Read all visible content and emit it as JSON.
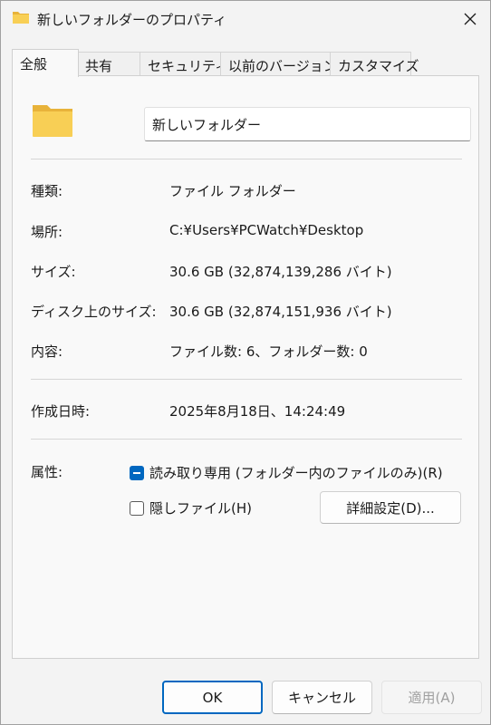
{
  "window": {
    "title": "新しいフォルダーのプロパティ"
  },
  "tabs": [
    {
      "label": "全般"
    },
    {
      "label": "共有"
    },
    {
      "label": "セキュリティ"
    },
    {
      "label": "以前のバージョン"
    },
    {
      "label": "カスタマイズ"
    }
  ],
  "general": {
    "name_value": "新しいフォルダー",
    "type_label": "種類:",
    "type_value": "ファイル フォルダー",
    "location_label": "場所:",
    "location_value": "C:¥Users¥PCWatch¥Desktop",
    "size_label": "サイズ:",
    "size_value": "30.6 GB (32,874,139,286 バイト)",
    "disk_size_label": "ディスク上のサイズ:",
    "disk_size_value": "30.6 GB (32,874,151,936 バイト)",
    "contents_label": "内容:",
    "contents_value": "ファイル数: 6、フォルダー数: 0",
    "created_label": "作成日時:",
    "created_value": "2025年8月18日、14:24:49",
    "attributes_label": "属性:",
    "readonly_label": "読み取り専用 (フォルダー内のファイルのみ)(R)",
    "hidden_label": "隠しファイル(H)",
    "advanced_label": "詳細設定(D)..."
  },
  "buttons": {
    "ok": "OK",
    "cancel": "キャンセル",
    "apply": "適用(A)"
  },
  "colors": {
    "accent": "#0067c0",
    "folder": "#f4c542"
  },
  "icons": {
    "title": "folder-icon",
    "close": "close-icon",
    "folder": "folder-icon"
  }
}
